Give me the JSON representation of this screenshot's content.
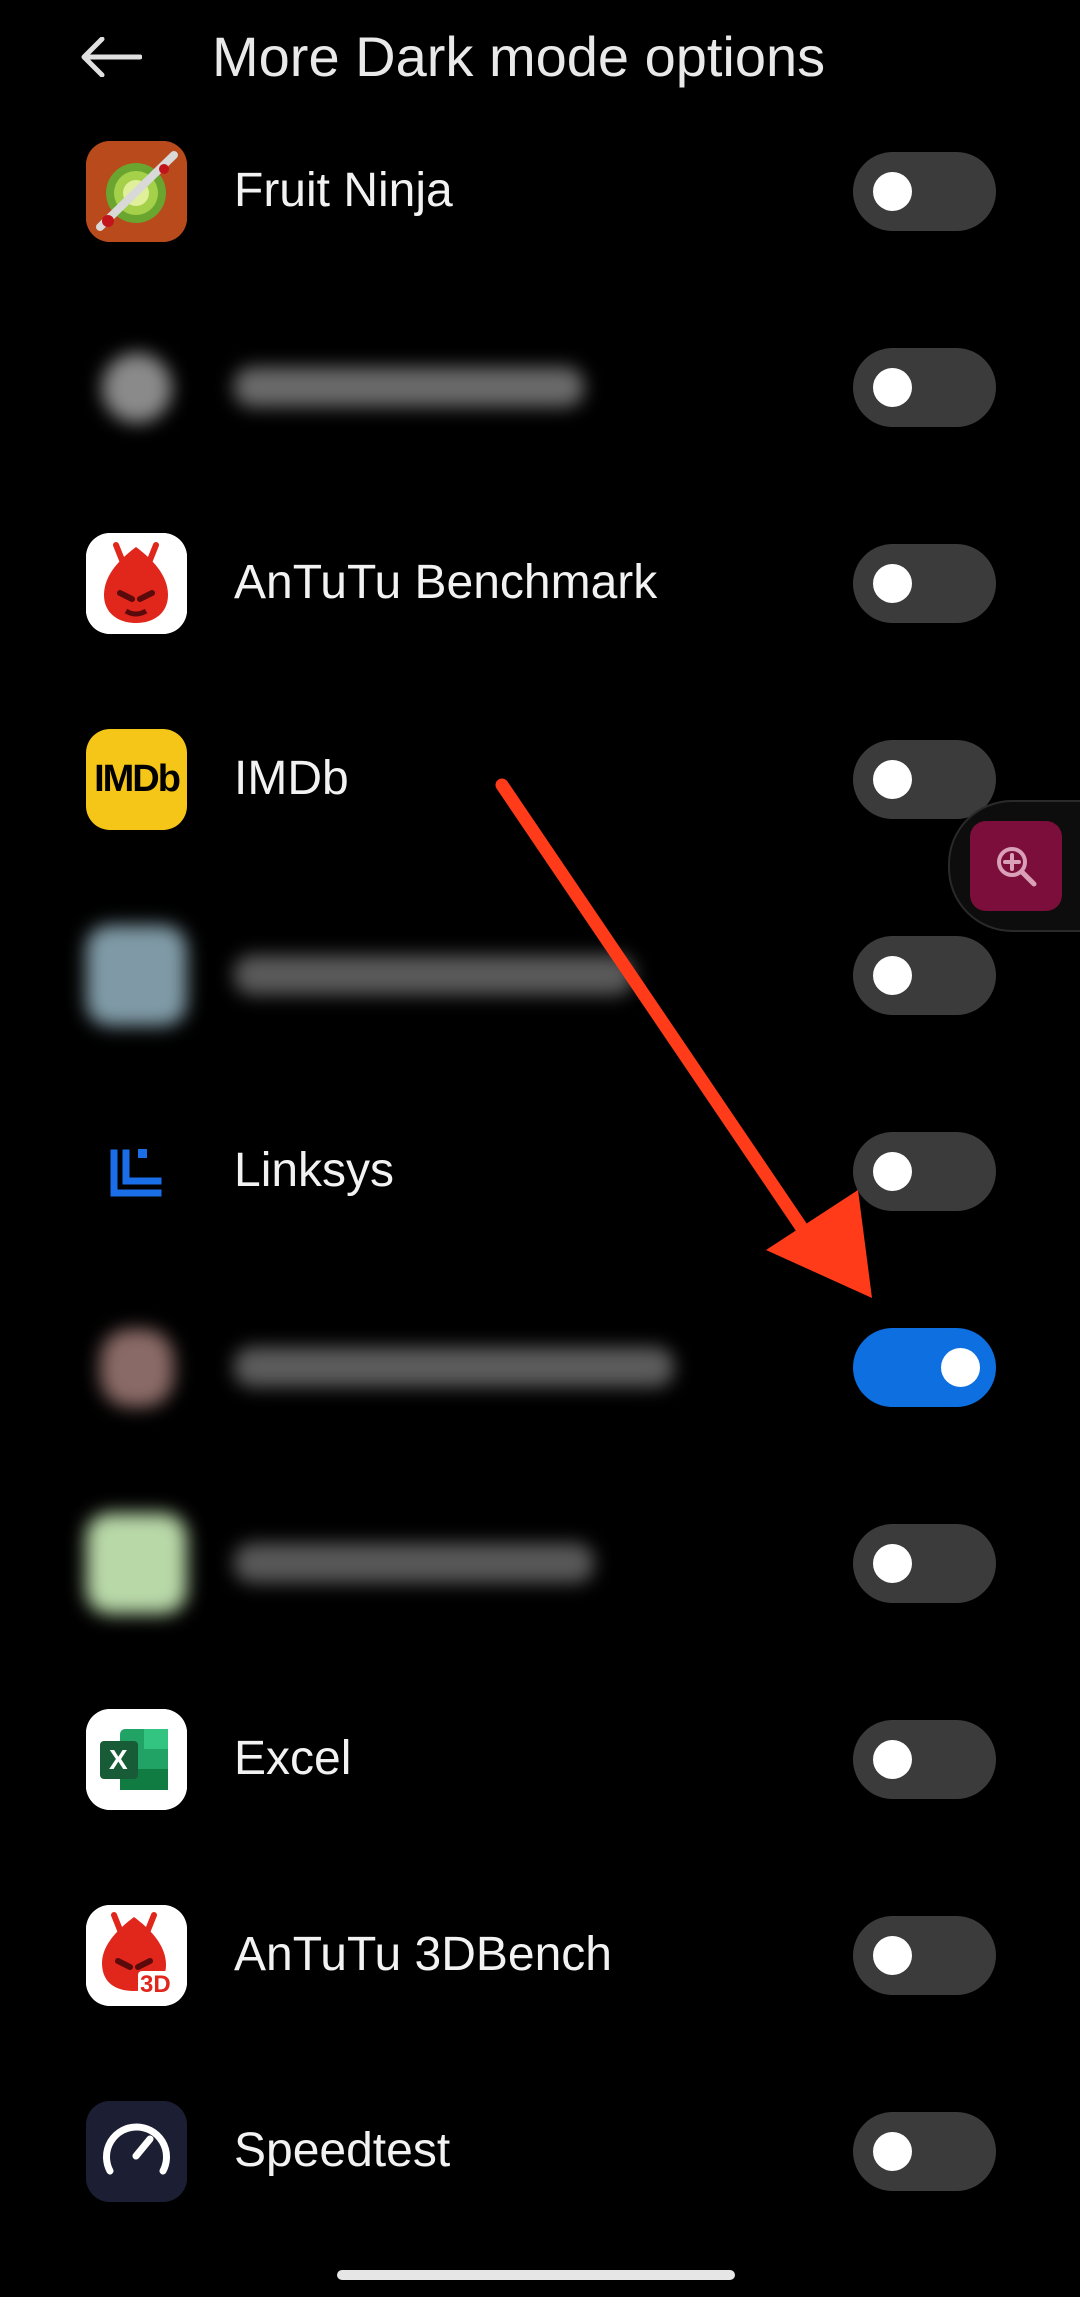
{
  "header": {
    "title": "More Dark mode options"
  },
  "apps": [
    {
      "label": "Fruit Ninja",
      "icon": "fruit-ninja-icon",
      "enabled": false,
      "blurred": false
    },
    {
      "label": "",
      "icon": "blurred-app-icon",
      "enabled": false,
      "blurred": true
    },
    {
      "label": "AnTuTu Benchmark",
      "icon": "antutu-icon",
      "enabled": false,
      "blurred": false
    },
    {
      "label": "IMDb",
      "icon": "imdb-icon",
      "icon_text": "IMDb",
      "enabled": false,
      "blurred": false
    },
    {
      "label": "",
      "icon": "blurred-app-icon",
      "enabled": false,
      "blurred": true
    },
    {
      "label": "Linksys",
      "icon": "linksys-icon",
      "enabled": false,
      "blurred": false
    },
    {
      "label": "",
      "icon": "blurred-app-icon",
      "enabled": true,
      "blurred": true
    },
    {
      "label": "",
      "icon": "blurred-app-icon",
      "enabled": false,
      "blurred": true
    },
    {
      "label": "Excel",
      "icon": "excel-icon",
      "icon_text": "X",
      "enabled": false,
      "blurred": false
    },
    {
      "label": "AnTuTu 3DBench",
      "icon": "antutu-3dbench-icon",
      "icon_text": "3D",
      "enabled": false,
      "blurred": false
    },
    {
      "label": "Speedtest",
      "icon": "speedtest-icon",
      "enabled": false,
      "blurred": false
    }
  ],
  "colors": {
    "background": "#000000",
    "toggle_off": "#3b3b3b",
    "toggle_on": "#0d6fe0",
    "annotation_arrow": "#ff3b1a",
    "zoom_button": "#7c0e3b"
  },
  "floating": {
    "icon": "zoom-in-icon"
  }
}
